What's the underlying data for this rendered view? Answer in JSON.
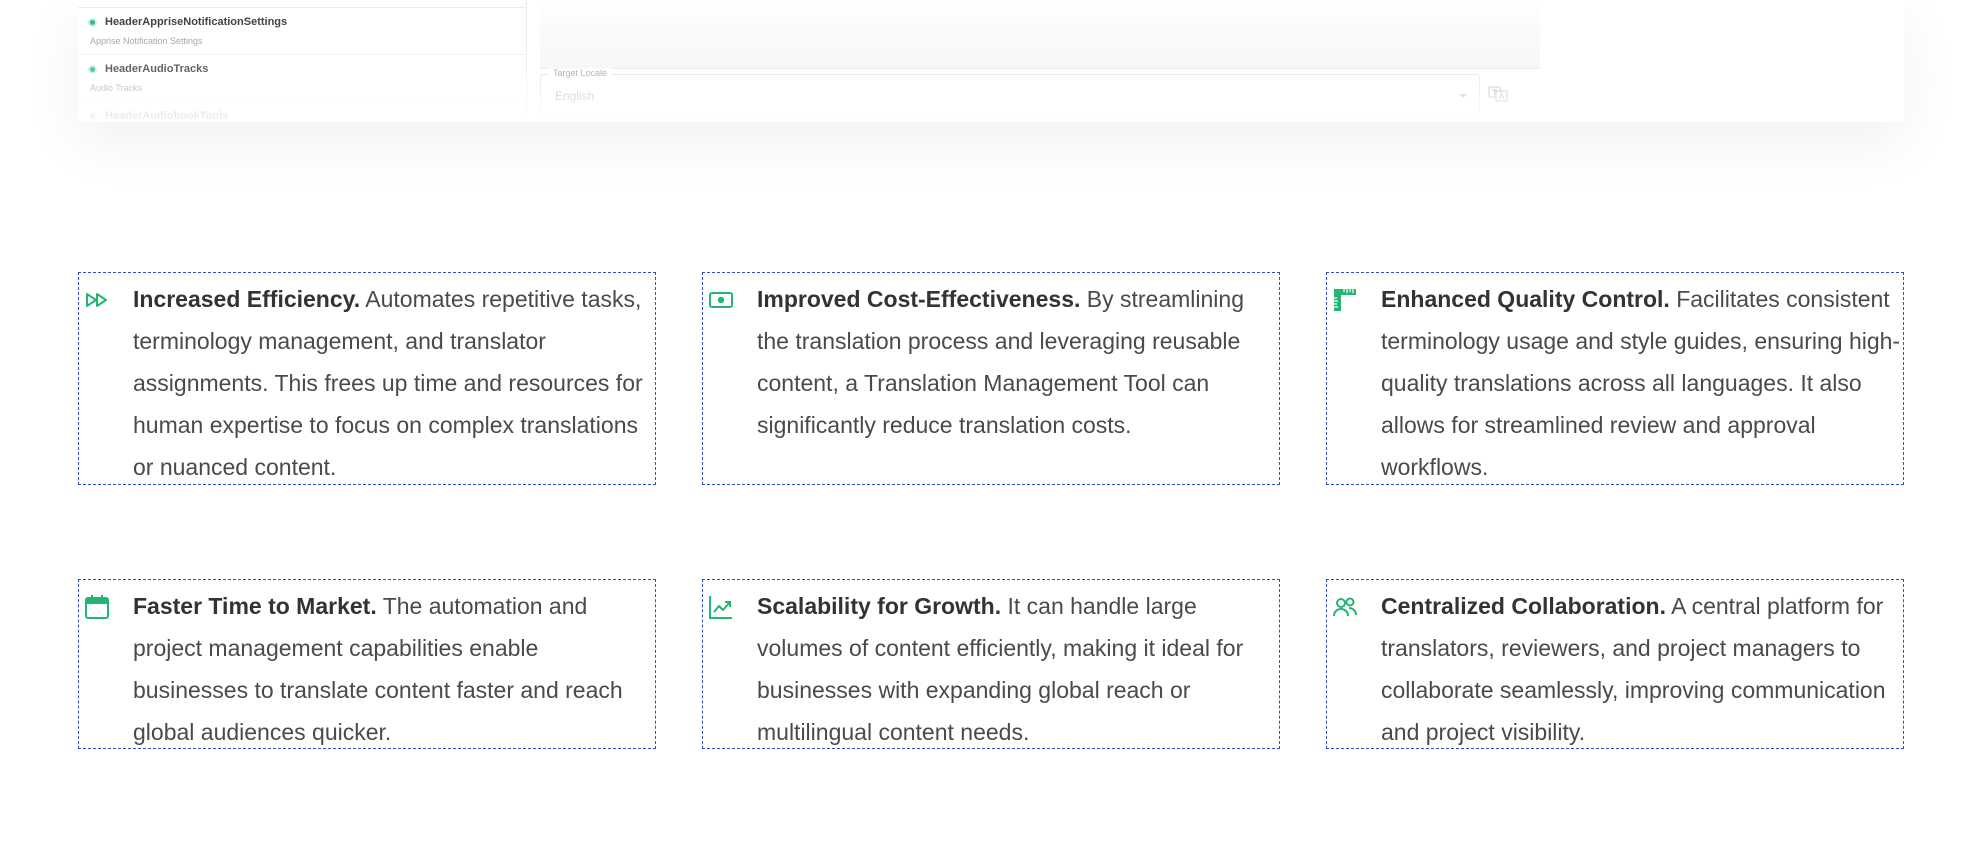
{
  "app_preview": {
    "list_items": [
      {
        "name": "HeaderAppriseNotificationSettings",
        "description": "Apprise Notification Settings"
      },
      {
        "name": "HeaderAudioTracks",
        "description": "Audio Tracks"
      },
      {
        "name": "HeaderAudiobookTools",
        "description": ""
      }
    ],
    "target_locale": {
      "label": "Target Locale",
      "value": "English"
    }
  },
  "features": [
    {
      "icon": "fast-forward-icon",
      "title": "Increased Efficiency.",
      "body": "Automates repetitive tasks, terminology management, and translator assignments. This frees up time and resources for human expertise to focus on complex translations or nuanced content."
    },
    {
      "icon": "cash-icon",
      "title": "Improved Cost-Effectiveness.",
      "body": "By streamlining the translation process and leveraging reusable content, a Translation Management Tool can significantly reduce translation costs."
    },
    {
      "icon": "ruler-icon",
      "title": "Enhanced Quality Control.",
      "body": "Facilitates consistent terminology usage and style guides, ensuring high-quality translations across all languages. It also allows for streamlined review and approval workflows."
    },
    {
      "icon": "calendar-icon",
      "title": "Faster Time to Market.",
      "body": "The automation and project management capabilities enable businesses to translate content faster and reach global audiences quicker."
    },
    {
      "icon": "trending-up-icon",
      "title": "Scalability for Growth.",
      "body": "It can handle large volumes of content efficiently, making it ideal for businesses with expanding global reach or multilingual content needs."
    },
    {
      "icon": "users-icon",
      "title": "Centralized Collaboration.",
      "body": "A central platform for translators, reviewers, and project managers to collaborate seamlessly, improving communication and project visibility."
    }
  ],
  "colors": {
    "accent": "#22b573",
    "card_border": "#2a4fd6",
    "text": "#4a4a4a"
  }
}
